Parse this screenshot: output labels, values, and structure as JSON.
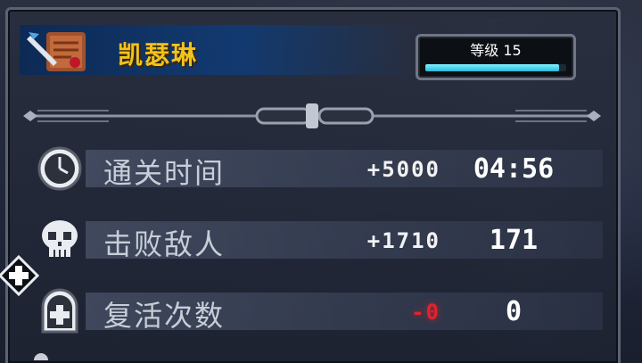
{
  "character": {
    "name": "凯瑟琳"
  },
  "level": {
    "label": "等级 15",
    "progress": 0.95
  },
  "stats": [
    {
      "icon": "clock-icon",
      "label": "通关时间",
      "bonus": "+5000",
      "value": "04:56",
      "negative": false
    },
    {
      "icon": "skull-icon",
      "label": "击败敌人",
      "bonus": "+1710",
      "value": "171",
      "negative": false
    },
    {
      "icon": "tombstone-cross-icon",
      "label": "复活次数",
      "bonus": "-0",
      "value": "0",
      "negative": true
    }
  ]
}
